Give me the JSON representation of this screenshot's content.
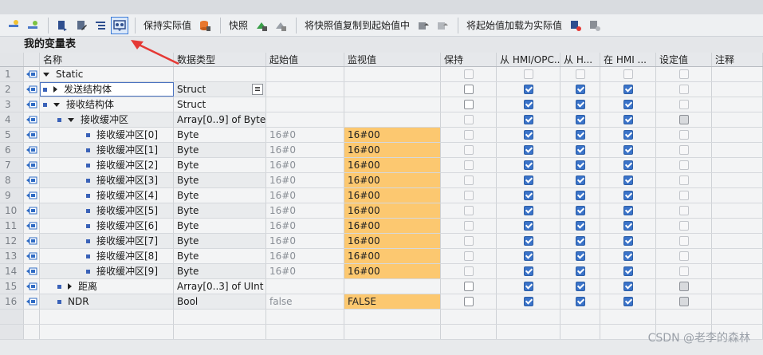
{
  "toolbar": {
    "keep_actual": "保持实际值",
    "snapshot": "快照",
    "copy_snapshot": "将快照值复制到起始值中",
    "load_start": "将起始值加载为实际值"
  },
  "table_title": "我的变量表",
  "columns": [
    "名称",
    "数据类型",
    "起始值",
    "监视值",
    "保持",
    "从 HMI/OPC..",
    "从 H...",
    "在 HMI ...",
    "设定值",
    "注释"
  ],
  "rows": [
    {
      "num": "1",
      "name": "Static",
      "type": "",
      "start": "",
      "mon": "",
      "indent": 0,
      "expander": "down",
      "dot": false,
      "keep": "dim",
      "hmi1": "dim",
      "hmi2": "dim",
      "hmi3": "dim",
      "set": "dim"
    },
    {
      "num": "2",
      "name": "发送结构体",
      "type": "Struct",
      "start": "",
      "mon": "",
      "indent": 1,
      "expander": "right",
      "dot": true,
      "keep": "normal",
      "hmi1": "checked",
      "hmi2": "checked",
      "hmi3": "checked",
      "set": "dim",
      "selected": true
    },
    {
      "num": "3",
      "name": "接收结构体",
      "type": "Struct",
      "start": "",
      "mon": "",
      "indent": 1,
      "expander": "down",
      "dot": true,
      "keep": "normal",
      "hmi1": "checked",
      "hmi2": "checked",
      "hmi3": "checked",
      "set": "dim"
    },
    {
      "num": "4",
      "name": "接收缓冲区",
      "type": "Array[0..9] of Byte",
      "start": "",
      "mon": "",
      "indent": 2,
      "expander": "down",
      "dot": true,
      "keep": "dim",
      "hmi1": "checked",
      "hmi2": "checked",
      "hmi3": "checked",
      "set": "grey"
    },
    {
      "num": "5",
      "name": "接收缓冲区[0]",
      "type": "Byte",
      "start": "16#0",
      "mon": "16#00",
      "indent": 3,
      "expander": "",
      "dot": true,
      "keep": "dim",
      "hmi1": "checked",
      "hmi2": "checked",
      "hmi3": "checked",
      "set": "dim",
      "orange": true
    },
    {
      "num": "6",
      "name": "接收缓冲区[1]",
      "type": "Byte",
      "start": "16#0",
      "mon": "16#00",
      "indent": 3,
      "expander": "",
      "dot": true,
      "keep": "dim",
      "hmi1": "checked",
      "hmi2": "checked",
      "hmi3": "checked",
      "set": "dim",
      "orange": true
    },
    {
      "num": "7",
      "name": "接收缓冲区[2]",
      "type": "Byte",
      "start": "16#0",
      "mon": "16#00",
      "indent": 3,
      "expander": "",
      "dot": true,
      "keep": "dim",
      "hmi1": "checked",
      "hmi2": "checked",
      "hmi3": "checked",
      "set": "dim",
      "orange": true
    },
    {
      "num": "8",
      "name": "接收缓冲区[3]",
      "type": "Byte",
      "start": "16#0",
      "mon": "16#00",
      "indent": 3,
      "expander": "",
      "dot": true,
      "keep": "dim",
      "hmi1": "checked",
      "hmi2": "checked",
      "hmi3": "checked",
      "set": "dim",
      "orange": true
    },
    {
      "num": "9",
      "name": "接收缓冲区[4]",
      "type": "Byte",
      "start": "16#0",
      "mon": "16#00",
      "indent": 3,
      "expander": "",
      "dot": true,
      "keep": "dim",
      "hmi1": "checked",
      "hmi2": "checked",
      "hmi3": "checked",
      "set": "dim",
      "orange": true
    },
    {
      "num": "10",
      "name": "接收缓冲区[5]",
      "type": "Byte",
      "start": "16#0",
      "mon": "16#00",
      "indent": 3,
      "expander": "",
      "dot": true,
      "keep": "dim",
      "hmi1": "checked",
      "hmi2": "checked",
      "hmi3": "checked",
      "set": "dim",
      "orange": true
    },
    {
      "num": "11",
      "name": "接收缓冲区[6]",
      "type": "Byte",
      "start": "16#0",
      "mon": "16#00",
      "indent": 3,
      "expander": "",
      "dot": true,
      "keep": "dim",
      "hmi1": "checked",
      "hmi2": "checked",
      "hmi3": "checked",
      "set": "dim",
      "orange": true
    },
    {
      "num": "12",
      "name": "接收缓冲区[7]",
      "type": "Byte",
      "start": "16#0",
      "mon": "16#00",
      "indent": 3,
      "expander": "",
      "dot": true,
      "keep": "dim",
      "hmi1": "checked",
      "hmi2": "checked",
      "hmi3": "checked",
      "set": "dim",
      "orange": true
    },
    {
      "num": "13",
      "name": "接收缓冲区[8]",
      "type": "Byte",
      "start": "16#0",
      "mon": "16#00",
      "indent": 3,
      "expander": "",
      "dot": true,
      "keep": "dim",
      "hmi1": "checked",
      "hmi2": "checked",
      "hmi3": "checked",
      "set": "dim",
      "orange": true
    },
    {
      "num": "14",
      "name": "接收缓冲区[9]",
      "type": "Byte",
      "start": "16#0",
      "mon": "16#00",
      "indent": 3,
      "expander": "",
      "dot": true,
      "keep": "dim",
      "hmi1": "checked",
      "hmi2": "checked",
      "hmi3": "checked",
      "set": "dim",
      "orange": true
    },
    {
      "num": "15",
      "name": "距离",
      "type": "Array[0..3] of UInt",
      "start": "",
      "mon": "",
      "indent": 2,
      "expander": "right",
      "dot": true,
      "keep": "normal",
      "hmi1": "checked",
      "hmi2": "checked",
      "hmi3": "checked",
      "set": "grey"
    },
    {
      "num": "16",
      "name": "NDR",
      "type": "Bool",
      "start": "false",
      "mon": "FALSE",
      "indent": 2,
      "expander": "",
      "dot": true,
      "keep": "normal",
      "hmi1": "checked",
      "hmi2": "checked",
      "hmi3": "checked",
      "set": "grey",
      "orange": true
    }
  ],
  "watermark": "CSDN @老李的森林",
  "colors": {
    "monitor_orange": "#fcc870",
    "checkbox_blue": "#3a73c9",
    "arrow_red": "#e53935"
  }
}
